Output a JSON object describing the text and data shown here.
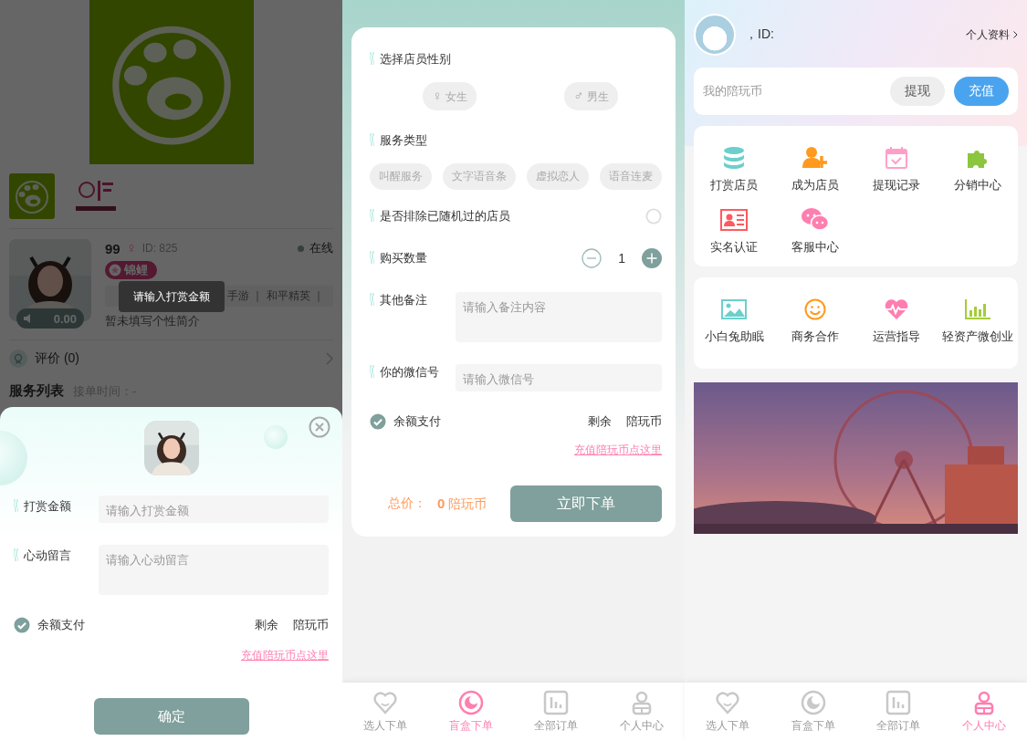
{
  "left_screen": {
    "profile": {
      "name": "99",
      "gender_symbol": "♀",
      "id": "ID: 825",
      "status": "在线",
      "badge": "锦鲤",
      "tags": [
        "手游 ｜ 和平精英 ｜"
      ],
      "voice_length": "0.00",
      "bio": "暂未填写个性简介"
    },
    "reviews": "评价 (0)",
    "services": {
      "title": "服务列表",
      "hours": "接单时间：-"
    },
    "toast": "请输入打赏金额",
    "reward_sheet": {
      "fields": [
        {
          "kind": "input",
          "label": "打赏金额",
          "placeholder": "请输入打赏金额"
        },
        {
          "kind": "textarea",
          "label": "心动留言",
          "placeholder": "请输入心动留言"
        }
      ],
      "balance_pay": {
        "label": "余额支付",
        "checked": true,
        "remaining": "剩余",
        "unit": "陪玩币"
      },
      "recharge_link": "充值陪玩币点这里",
      "confirm": "确定"
    }
  },
  "order_screen": {
    "gender": {
      "title": "选择店员性别",
      "options": [
        {
          "symbol": "♀",
          "label": "女生",
          "selected": false
        },
        {
          "symbol": "♂",
          "label": "男生",
          "selected": false
        }
      ]
    },
    "service_type": {
      "title": "服务类型",
      "options": [
        {
          "label": "叫醒服务",
          "selected": false
        },
        {
          "label": "文字语音条",
          "selected": false
        },
        {
          "label": "虚拟恋人",
          "selected": false
        },
        {
          "label": "语音连麦",
          "selected": false
        }
      ]
    },
    "exclude_random": {
      "label": "是否排除已随机过的店员",
      "checked": false
    },
    "quantity": {
      "label": "购买数量",
      "value": "1"
    },
    "notes": {
      "label": "其他备注",
      "placeholder": "请输入备注内容"
    },
    "wechat": {
      "label": "你的微信号",
      "placeholder": "请输入微信号"
    },
    "balance_pay": {
      "label": "余额支付",
      "checked": true,
      "remaining": "剩余",
      "unit": "陪玩币"
    },
    "recharge_link": "充值陪玩币点这里",
    "total": {
      "label": "总价：",
      "value": "0",
      "unit": "陪玩币"
    },
    "submit": "立即下单",
    "tab_bar": [
      {
        "label": "选人下单",
        "selected": false
      },
      {
        "label": "盲盒下单",
        "selected": true
      },
      {
        "label": "全部订单",
        "selected": false
      },
      {
        "label": "个人中心",
        "selected": false
      }
    ]
  },
  "me_screen": {
    "id_label": "，ID:",
    "profile_link": "个人资料",
    "wallet": {
      "label": "我的陪玩币",
      "buttons": [
        {
          "kind": "secondary",
          "label": "提现"
        },
        {
          "kind": "primary",
          "label": "充值"
        }
      ]
    },
    "menu": [
      {
        "label": "打赏店员"
      },
      {
        "label": "成为店员"
      },
      {
        "label": "提现记录"
      },
      {
        "label": "分销中心"
      },
      {
        "label": "实名认证"
      },
      {
        "label": "客服中心"
      }
    ],
    "more": [
      {
        "label": "小白兔助眠"
      },
      {
        "label": "商务合作"
      },
      {
        "label": "运营指导"
      },
      {
        "label": "轻资产微创业"
      }
    ],
    "tab_bar": [
      {
        "label": "选人下单",
        "selected": false
      },
      {
        "label": "盲盒下单",
        "selected": false
      },
      {
        "label": "全部订单",
        "selected": false
      },
      {
        "label": "个人中心",
        "selected": true
      }
    ]
  }
}
